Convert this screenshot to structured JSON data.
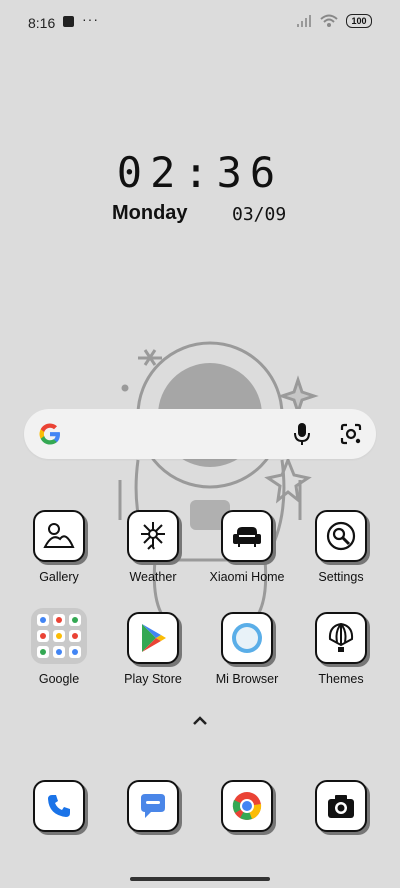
{
  "status_bar": {
    "time": "8:16",
    "dots": "···",
    "battery": "100"
  },
  "lockscreen_widget": {
    "clock": "02:36",
    "day": "Monday",
    "date": "03/09"
  },
  "search": {
    "logo": "google-g-icon",
    "mic_icon": "mic-icon",
    "lens_icon": "google-lens-icon"
  },
  "apps_row1": [
    {
      "label": "Gallery",
      "icon": "gallery-icon"
    },
    {
      "label": "Weather",
      "icon": "weather-icon"
    },
    {
      "label": "Xiaomi Home",
      "icon": "sofa-icon"
    },
    {
      "label": "Settings",
      "icon": "settings-icon"
    }
  ],
  "apps_row2": [
    {
      "label": "Google",
      "icon": "folder-icon"
    },
    {
      "label": "Play Store",
      "icon": "play-store-icon"
    },
    {
      "label": "Mi Browser",
      "icon": "browser-icon"
    },
    {
      "label": "Themes",
      "icon": "themes-icon"
    }
  ],
  "dock": [
    {
      "icon": "phone-icon"
    },
    {
      "icon": "messages-icon"
    },
    {
      "icon": "chrome-icon"
    },
    {
      "icon": "camera-icon"
    }
  ],
  "colors": {
    "background": "#dcdcdc",
    "search_bg": "#f2f2f2",
    "icon_border": "#111111",
    "accent_blue": "#4285f4",
    "accent_red": "#ea4335",
    "accent_yellow": "#fbbc05",
    "accent_green": "#34a853"
  }
}
